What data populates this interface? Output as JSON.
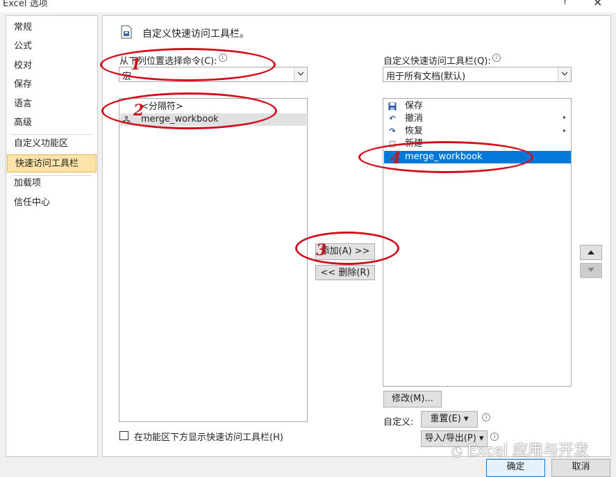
{
  "window": {
    "title": "Excel 选项",
    "help": "?",
    "close": "✕"
  },
  "nav": {
    "items": [
      "常规",
      "公式",
      "校对",
      "保存",
      "语言",
      "高级",
      "自定义功能区",
      "快速访问工具栏",
      "加载项",
      "信任中心"
    ],
    "active_index": 7
  },
  "section": {
    "title": "自定义快速访问工具栏。"
  },
  "left": {
    "choose_label": "从下列位置选择命令(C):",
    "choose_value": "宏",
    "list": [
      {
        "label": "<分隔符>",
        "icon": "separator-icon"
      },
      {
        "label": "merge_workbook",
        "icon": "macro-icon"
      }
    ]
  },
  "right": {
    "qat_label": "自定义快速访问工具栏(Q):",
    "qat_value": "用于所有文档(默认)",
    "list": [
      {
        "label": "保存",
        "icon": "save-icon",
        "glyph": "💾"
      },
      {
        "label": "撤消",
        "icon": "undo-icon",
        "glyph": "↶"
      },
      {
        "label": "恢复",
        "icon": "redo-icon",
        "glyph": "↷"
      },
      {
        "label": "新建",
        "icon": "new-document-icon",
        "glyph": "□"
      },
      {
        "label": "merge_workbook",
        "icon": "macro-icon",
        "glyph": ""
      }
    ],
    "modify_btn": "修改(M)...",
    "customize_label": "自定义:",
    "reset_btn": "重置(E) ▾",
    "import_export_btn": "导入/导出(P) ▾"
  },
  "middle": {
    "add_btn": "添加(A) >>",
    "remove_btn": "<< 删除(R)"
  },
  "footer": {
    "checkbox_label": "在功能区下方显示快速访问工具栏(H)",
    "ok_btn": "确定",
    "cancel_btn": "取消"
  },
  "annotations": [
    "1",
    "2",
    "3",
    "4"
  ],
  "watermark": "Excel 应用与开发",
  "colors": {
    "annotation": "#d40f1d",
    "selection": "#0078d7",
    "nav_active": "#fce4a8"
  }
}
